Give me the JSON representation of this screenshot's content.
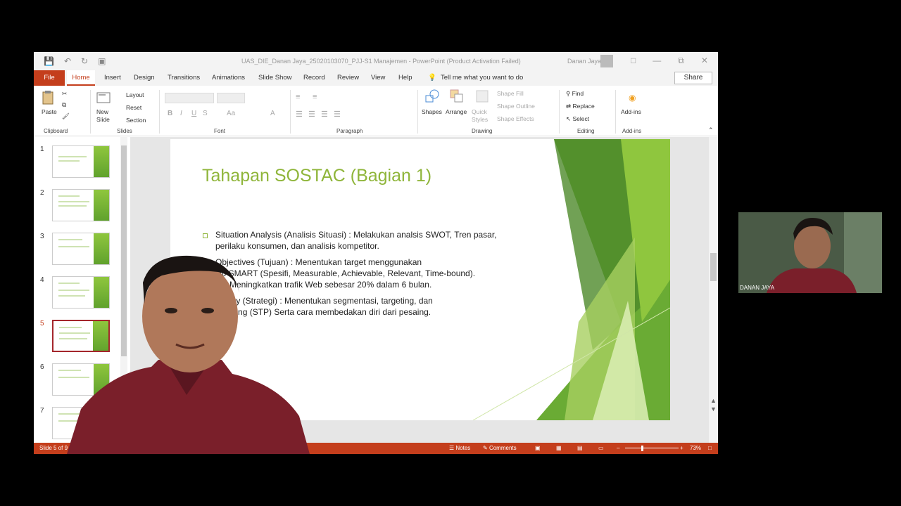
{
  "window": {
    "title": "UAS_DIE_Danan Jaya_25020103070_PJJ-S1 Manajemen  -  PowerPoint (Product Activation Failed)",
    "user": "Danan Jaya"
  },
  "tabs": {
    "file": "File",
    "home": "Home",
    "insert": "Insert",
    "design": "Design",
    "transitions": "Transitions",
    "animations": "Animations",
    "slideshow": "Slide Show",
    "record": "Record",
    "review": "Review",
    "view": "View",
    "help": "Help",
    "tellme": "Tell me what you want to do",
    "share": "Share"
  },
  "ribbon": {
    "paste": "Paste",
    "clipboard": "Clipboard",
    "new_slide": "New Slide",
    "layout": "Layout",
    "reset": "Reset",
    "section": "Section",
    "slides": "Slides",
    "font": "Font",
    "paragraph": "Paragraph",
    "shapes": "Shapes",
    "arrange": "Arrange",
    "quick_styles": "Quick Styles",
    "shape_fill": "Shape Fill",
    "shape_outline": "Shape Outline",
    "shape_effects": "Shape Effects",
    "drawing": "Drawing",
    "find": "Find",
    "replace": "Replace",
    "select": "Select",
    "editing": "Editing",
    "addins_btn": "Add-ins",
    "addins": "Add-ins"
  },
  "thumbnails": [
    "1",
    "2",
    "3",
    "4",
    "5",
    "6",
    "7"
  ],
  "selected_slide": 5,
  "slide": {
    "title": "Tahapan SOSTAC (Bagian 1)",
    "lines": [
      "Situation Analysis (Analisis Situasi)    : Melakukan analsis SWOT, Tren pasar,",
      "perilaku konsumen, dan analisis kompetitor.",
      "Objectives (Tujuan)                               : Menentukan target menggunakan",
      "sip SMART (Spesifi, Measurable, Achievable, Relevant, Time-bound).",
      "oh: Meningkatkan trafik Web sebesar 20% dalam 6 bulan.",
      "egy (Strategi)                                 : Menentukan segmentasi, targeting, dan",
      "oning (STP) Serta cara membedakan diri dari pesaing."
    ]
  },
  "status": {
    "slide_info": "Slide 5 of 9",
    "notes": "Notes",
    "comments": "Comments",
    "zoom": "73%"
  },
  "webcam": {
    "label": "DANAN JAYA"
  },
  "colors": {
    "accent": "#c43e1c",
    "slide_green": "#8fb53a"
  }
}
